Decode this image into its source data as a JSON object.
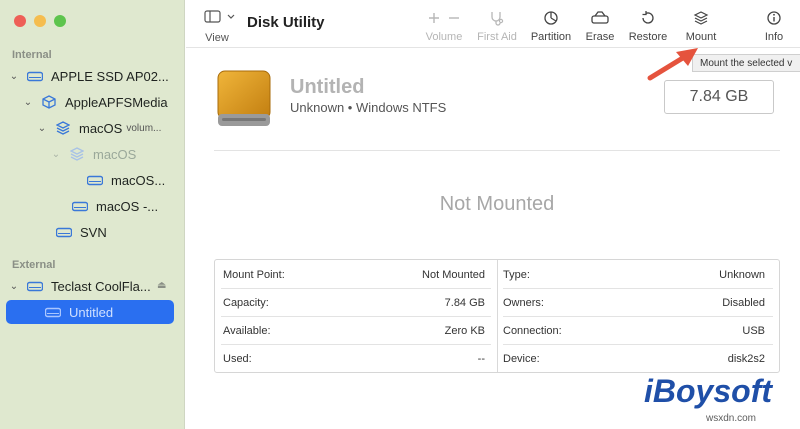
{
  "window": {
    "title": "Disk Utility"
  },
  "sidebar": {
    "internal_heading": "Internal",
    "external_heading": "External",
    "items": [
      {
        "label": "APPLE SSD AP02..."
      },
      {
        "label": "AppleAPFSMedia"
      },
      {
        "label": "macOS",
        "sublabel": "volum..."
      },
      {
        "label": "macOS"
      },
      {
        "label": "macOS..."
      },
      {
        "label": "macOS -..."
      },
      {
        "label": "SVN"
      },
      {
        "label": "Teclast CoolFla..."
      },
      {
        "label": "Untitled"
      }
    ]
  },
  "toolbar": {
    "view_label": "View",
    "volume_label": "Volume",
    "first_aid_label": "First Aid",
    "partition_label": "Partition",
    "erase_label": "Erase",
    "restore_label": "Restore",
    "mount_label": "Mount",
    "info_label": "Info"
  },
  "tooltip": "Mount the selected v",
  "volume": {
    "name": "Untitled",
    "subtitle": "Unknown • Windows NTFS",
    "size": "7.84 GB",
    "status": "Not Mounted"
  },
  "details": {
    "left": [
      {
        "key": "Mount Point:",
        "value": "Not Mounted"
      },
      {
        "key": "Capacity:",
        "value": "7.84 GB"
      },
      {
        "key": "Available:",
        "value": "Zero KB"
      },
      {
        "key": "Used:",
        "value": "--"
      }
    ],
    "right": [
      {
        "key": "Type:",
        "value": "Unknown"
      },
      {
        "key": "Owners:",
        "value": "Disabled"
      },
      {
        "key": "Connection:",
        "value": "USB"
      },
      {
        "key": "Device:",
        "value": "disk2s2"
      }
    ]
  },
  "watermark": {
    "brand": "iBoysoft",
    "credit": "wsxdn.com"
  },
  "colors": {
    "sidebar_bg": "#dfe8cf",
    "selection": "#2a6ff0",
    "drive": "#d99a1f",
    "arrow": "#e5533d",
    "brand": "#1f4fa8"
  }
}
